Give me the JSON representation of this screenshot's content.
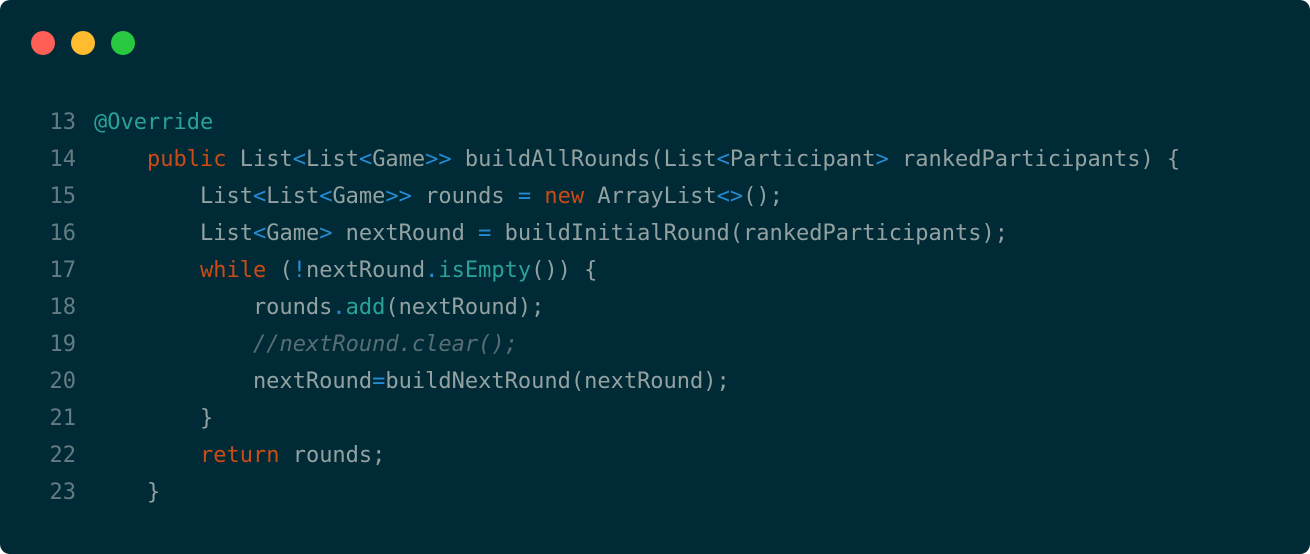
{
  "window": {
    "background": "#002b36",
    "buttons": {
      "close": {
        "color": "#ff5f57",
        "icon": "close-dot"
      },
      "minimize": {
        "color": "#febc2e",
        "icon": "minimize-dot"
      },
      "maximize": {
        "color": "#28c840",
        "icon": "maximize-dot"
      }
    }
  },
  "colors": {
    "plain": "#93a1a1",
    "line_number": "#657b83",
    "keyword": "#cb4b16",
    "operator": "#268bd2",
    "method_annotation": "#2aa198",
    "comment": "#586e75"
  },
  "code": {
    "lines": [
      {
        "number": "13",
        "tokens": [
          {
            "t": "@Override",
            "c": "ann"
          }
        ]
      },
      {
        "number": "14",
        "tokens": [
          {
            "t": "    ",
            "c": "tx"
          },
          {
            "t": "public",
            "c": "kw"
          },
          {
            "t": " List",
            "c": "tx"
          },
          {
            "t": "<",
            "c": "op"
          },
          {
            "t": "List",
            "c": "tx"
          },
          {
            "t": "<",
            "c": "op"
          },
          {
            "t": "Game",
            "c": "tx"
          },
          {
            "t": ">>",
            "c": "op"
          },
          {
            "t": " buildAllRounds(List",
            "c": "tx"
          },
          {
            "t": "<",
            "c": "op"
          },
          {
            "t": "Participant",
            "c": "tx"
          },
          {
            "t": ">",
            "c": "op"
          },
          {
            "t": " rankedParticipants) {",
            "c": "tx"
          }
        ]
      },
      {
        "number": "15",
        "tokens": [
          {
            "t": "        List",
            "c": "tx"
          },
          {
            "t": "<",
            "c": "op"
          },
          {
            "t": "List",
            "c": "tx"
          },
          {
            "t": "<",
            "c": "op"
          },
          {
            "t": "Game",
            "c": "tx"
          },
          {
            "t": ">>",
            "c": "op"
          },
          {
            "t": " rounds ",
            "c": "tx"
          },
          {
            "t": "=",
            "c": "op"
          },
          {
            "t": " ",
            "c": "tx"
          },
          {
            "t": "new",
            "c": "kw"
          },
          {
            "t": " ArrayList",
            "c": "tx"
          },
          {
            "t": "<>",
            "c": "op"
          },
          {
            "t": "();",
            "c": "tx"
          }
        ]
      },
      {
        "number": "16",
        "tokens": [
          {
            "t": "        List",
            "c": "tx"
          },
          {
            "t": "<",
            "c": "op"
          },
          {
            "t": "Game",
            "c": "tx"
          },
          {
            "t": ">",
            "c": "op"
          },
          {
            "t": " nextRound ",
            "c": "tx"
          },
          {
            "t": "=",
            "c": "op"
          },
          {
            "t": " buildInitialRound(rankedParticipants);",
            "c": "tx"
          }
        ]
      },
      {
        "number": "17",
        "tokens": [
          {
            "t": "        ",
            "c": "tx"
          },
          {
            "t": "while",
            "c": "kw"
          },
          {
            "t": " (",
            "c": "tx"
          },
          {
            "t": "!",
            "c": "op"
          },
          {
            "t": "nextRound",
            "c": "tx"
          },
          {
            "t": ".",
            "c": "op"
          },
          {
            "t": "isEmpty",
            "c": "fn"
          },
          {
            "t": "()) {",
            "c": "tx"
          }
        ]
      },
      {
        "number": "18",
        "tokens": [
          {
            "t": "            rounds",
            "c": "tx"
          },
          {
            "t": ".",
            "c": "op"
          },
          {
            "t": "add",
            "c": "fn"
          },
          {
            "t": "(nextRound);",
            "c": "tx"
          }
        ]
      },
      {
        "number": "19",
        "tokens": [
          {
            "t": "            ",
            "c": "tx"
          },
          {
            "t": "//nextRound.clear();",
            "c": "cm"
          }
        ]
      },
      {
        "number": "20",
        "tokens": [
          {
            "t": "            nextRound",
            "c": "tx"
          },
          {
            "t": "=",
            "c": "op"
          },
          {
            "t": "buildNextRound(nextRound);",
            "c": "tx"
          }
        ]
      },
      {
        "number": "21",
        "tokens": [
          {
            "t": "        }",
            "c": "tx"
          }
        ]
      },
      {
        "number": "22",
        "tokens": [
          {
            "t": "        ",
            "c": "tx"
          },
          {
            "t": "return",
            "c": "kw"
          },
          {
            "t": " rounds;",
            "c": "tx"
          }
        ]
      },
      {
        "number": "23",
        "tokens": [
          {
            "t": "    }",
            "c": "tx"
          }
        ]
      }
    ]
  }
}
